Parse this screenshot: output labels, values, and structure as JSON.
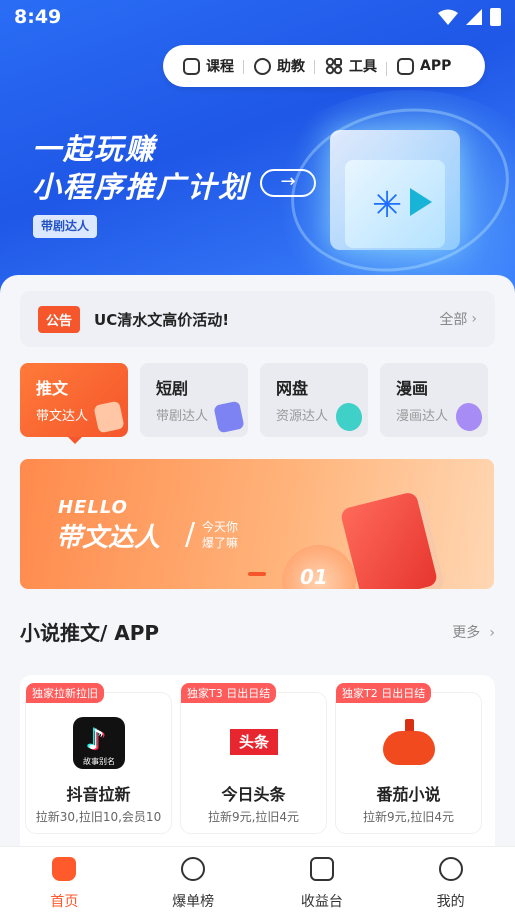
{
  "status_bar": {
    "time": "8:49"
  },
  "quick_nav": [
    {
      "label": "课程",
      "icon": "course-icon"
    },
    {
      "label": "助教",
      "icon": "assistant-icon"
    },
    {
      "label": "工具",
      "icon": "tools-icon"
    },
    {
      "label": "APP",
      "icon": "app-icon"
    }
  ],
  "hero": {
    "title_line1": "一起玩赚",
    "title_line2": "小程序推广计划",
    "arrow": "→",
    "badge": "带剧达人"
  },
  "notice": {
    "tag": "公告",
    "text": "UC清水文高价活动!",
    "more": "全部"
  },
  "categories": [
    {
      "title": "推文",
      "subtitle": "带文达人",
      "active": true,
      "icon_color": "#ffb38a"
    },
    {
      "title": "短剧",
      "subtitle": "带剧达人",
      "active": false,
      "icon_color": "#7d83f2"
    },
    {
      "title": "网盘",
      "subtitle": "资源达人",
      "active": false,
      "icon_color": "#3fd0c8"
    },
    {
      "title": "漫画",
      "subtitle": "漫画达人",
      "active": false,
      "icon_color": "#a88cf5"
    }
  ],
  "banner": {
    "hello": "HELLO",
    "headline": "带文达人",
    "slash": "/",
    "sub_line1": "今天你",
    "sub_line2": "爆了嘛",
    "number": "01"
  },
  "section": {
    "title": "小说推文/ APP",
    "more": "更多"
  },
  "apps": [
    {
      "tag": "独家拉新拉旧",
      "name": "抖音拉新",
      "desc": "拉新30,拉旧10,会员10",
      "logo_caption": "故事别名",
      "logo": "douyin"
    },
    {
      "tag": "独家T3 日出日结",
      "name": "今日头条",
      "desc": "拉新9元,拉旧4元",
      "logo_text": "头条",
      "logo": "toutiao"
    },
    {
      "tag": "独家T2 日出日结",
      "name": "番茄小说",
      "desc": "拉新9元,拉旧4元",
      "logo": "fanqie"
    }
  ],
  "tabbar": [
    {
      "label": "首页",
      "icon": "home-icon",
      "active": true
    },
    {
      "label": "爆单榜",
      "icon": "lightning-icon",
      "active": false
    },
    {
      "label": "收益台",
      "icon": "earnings-icon",
      "active": false
    },
    {
      "label": "我的",
      "icon": "profile-icon",
      "active": false
    }
  ],
  "colors": {
    "accent": "#f5562b",
    "hero_blue": "#1f57e6"
  }
}
